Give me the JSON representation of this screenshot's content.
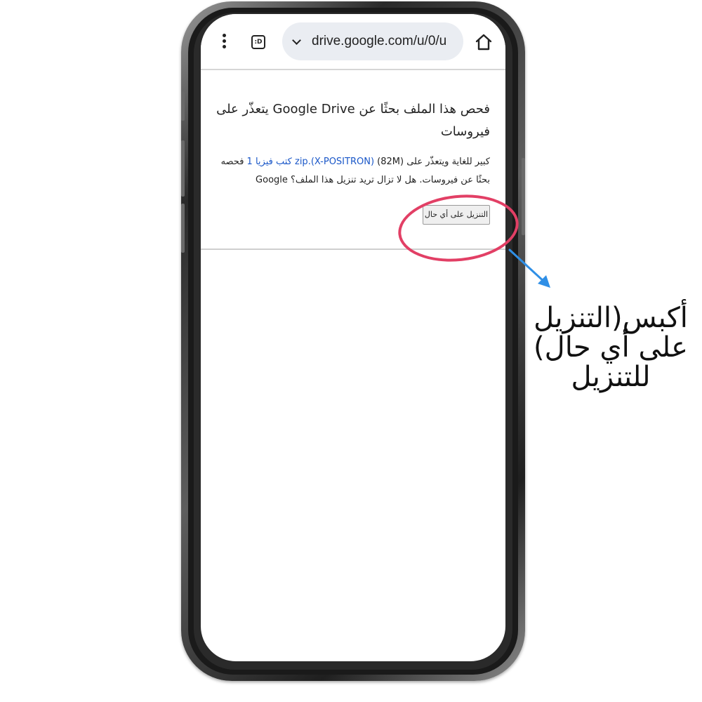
{
  "browser": {
    "tab_icon_label": ":D",
    "url": "drive.google.com/u/0/u",
    "icons": [
      "menu-dots-icon",
      "tab-switcher-icon",
      "chevron-down-icon",
      "home-icon"
    ]
  },
  "page": {
    "heading": "فحص هذا الملف بحثًا عن Google Drive يتعذّر على فيروسات",
    "body_prefix": "كبير للغاية ويتعذّر على (82M) ",
    "file_link": "(X-POSITRON).zip كتب فيزيا 1",
    "body_suffix": " فحصه بحثًا عن فيروسات. هل لا تزال تريد تنزيل هذا الملف؟ Google",
    "download_button": "التنزيل على أي حال"
  },
  "annotation": {
    "instruction_text": "أكبس(التنزيل على أي حال) للتنزيل",
    "highlight_color": "#e23f65",
    "arrow_color": "#2f8fe6"
  }
}
